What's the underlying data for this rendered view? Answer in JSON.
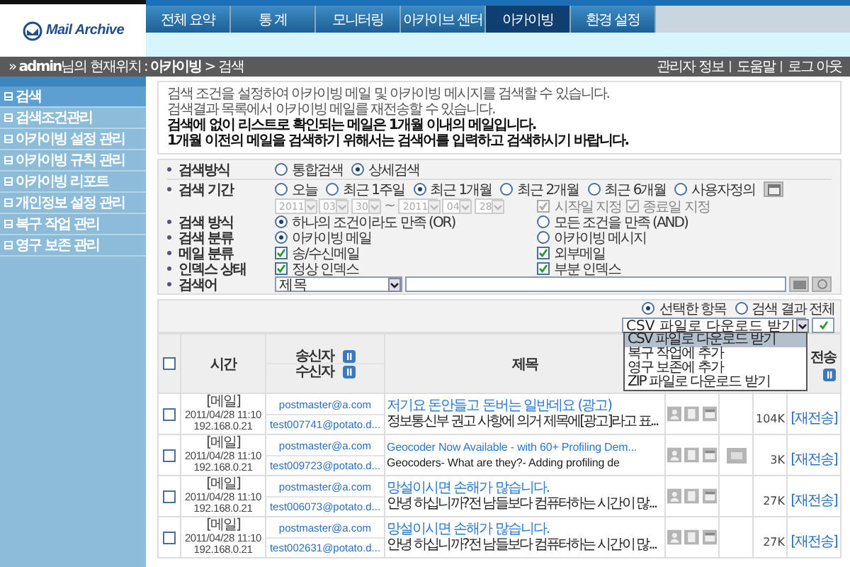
{
  "logo": {
    "text": "Mail Archive"
  },
  "top_tabs": [
    {
      "label": "전체 요약",
      "selected": false
    },
    {
      "label": "통 계",
      "selected": false
    },
    {
      "label": "모니터링",
      "selected": false
    },
    {
      "label": "아카이브 센터",
      "selected": false
    },
    {
      "label": "아카이빙",
      "selected": true
    },
    {
      "label": "환경 설정",
      "selected": false
    }
  ],
  "breadcrumb": {
    "location": "» **admin**님의 현재위치 : **아카이빙** > 검색",
    "links": [
      "관리자 정보",
      "도움말",
      "로그 아웃"
    ]
  },
  "sidebar": {
    "items": [
      {
        "label": "검색",
        "selected": true
      },
      {
        "label": "검색조건관리",
        "selected": false
      },
      {
        "label": "아카이빙 설정 관리",
        "selected": false
      },
      {
        "label": "아카이빙 규칙 관리",
        "selected": false
      },
      {
        "label": "아카이빙 리포트",
        "selected": false
      },
      {
        "label": "개인정보 설정 관리",
        "selected": false
      },
      {
        "label": "복구 작업 관리",
        "selected": false
      },
      {
        "label": "영구 보존 관리",
        "selected": false
      }
    ]
  },
  "notice": {
    "lines": [
      {
        "text": "검색 조건을 설정하여 아카이빙 메일 및 아카이빙 메시지를 검색할 수 있습니다.",
        "bold": false
      },
      {
        "text": "검색결과 목록에서 아카이빙 메일를 재전송할 수 있습니다.",
        "bold": false
      },
      {
        "text": "검색에 없이 리스트로 확인되는 메일은 1개월 이내의 메일입니다.",
        "bold": true
      },
      {
        "text": "1개월 이전의 메일을 검색하기 위해서는 검색어를 입력하고 검색하시기 바랍니다.",
        "bold": true
      }
    ]
  },
  "search_form": {
    "rows": [
      {
        "kind": "radio",
        "label": "검색방식",
        "options": [
          {
            "label": "통합검색",
            "selected": false
          },
          {
            "label": "상세검색",
            "selected": true
          }
        ]
      },
      {
        "kind": "period",
        "label": "검색 기간",
        "options": [
          {
            "label": "오늘",
            "selected": false
          },
          {
            "label": "최근 1주일",
            "selected": false
          },
          {
            "label": "최근 1개월",
            "selected": true
          },
          {
            "label": "최근 2개월",
            "selected": false
          },
          {
            "label": "최근 6개월",
            "selected": false
          },
          {
            "label": "사용자정의",
            "selected": false
          }
        ],
        "disabled": true,
        "start": [
          "2011",
          "03",
          "30"
        ],
        "separator": "~",
        "end": [
          "2011",
          "04",
          "28"
        ],
        "checks": [
          {
            "label": "시작일 지정",
            "checked": true
          },
          {
            "label": "종료일 지정",
            "checked": true
          }
        ]
      },
      {
        "kind": "radio",
        "label": "검색 방식",
        "options": [
          {
            "label": "하나의 조건이라도 만족 (OR)",
            "selected": true
          },
          {
            "label": "모든 조건을 만족 (AND)",
            "selected": false
          }
        ]
      },
      {
        "kind": "radio",
        "label": "검색 분류",
        "options": [
          {
            "label": "아카이빙 메일",
            "selected": true
          },
          {
            "label": "아카이빙 메시지",
            "selected": false
          }
        ]
      },
      {
        "kind": "check",
        "label": "메일 분류",
        "options": [
          {
            "label": "송/수신메일",
            "checked": true
          },
          {
            "label": "외부메일",
            "checked": true
          }
        ]
      },
      {
        "kind": "check",
        "label": "인덱스 상태",
        "options": [
          {
            "label": "정상 인덱스",
            "checked": true
          },
          {
            "label": "부분 인덱스",
            "checked": true
          }
        ]
      },
      {
        "kind": "keyword",
        "label": "검색어",
        "field": "제목"
      }
    ]
  },
  "export": {
    "scope": [
      {
        "label": "선택한 항목",
        "selected": true
      },
      {
        "label": "검색 결과 전체",
        "selected": false
      }
    ],
    "action": "CSV 파일로 다운로드 받기",
    "menu": [
      {
        "label": "CSV 파일로 다운로드 받기",
        "selected": true
      },
      {
        "label": "복구 작업에 추가",
        "selected": false
      },
      {
        "label": "영구 보존에 추가",
        "selected": false
      },
      {
        "label": "ZIP 파일로 다운로드 받기",
        "selected": false
      }
    ]
  },
  "table": {
    "select_all": {
      "checked": false
    },
    "columns": {
      "time": "시간",
      "sender": "송신자",
      "recipient": "수신자",
      "subject": "제목",
      "resend": "전송"
    },
    "rows": [
      {
        "checked": false,
        "type": "[메일]",
        "date": "2011/04/28 11:10",
        "ip": "192.168.0.21",
        "sender": "postmaster@a.com",
        "recipient": "test007741@potato.d...",
        "title": "저기요 돈안들고 돈버는 일반데요 (광고)",
        "preview": "정보통신부 권고 사항에 의거 제목에[광고]라고 표...",
        "attachment": false,
        "size": "104K",
        "resend": "[재전송]"
      },
      {
        "checked": false,
        "type": "[메일]",
        "date": "2011/04/28 11:10",
        "ip": "192.168.0.21",
        "sender": "postmaster@a.com",
        "recipient": "test009723@potato.d...",
        "title": "Geocoder Now Available - with 60+ Profiling Dem...",
        "preview": "Geocoders- What are they?- Adding profiling de",
        "attachment": true,
        "size": "3K",
        "resend": "[재전송]"
      },
      {
        "checked": false,
        "type": "[메일]",
        "date": "2011/04/28 11:10",
        "ip": "192.168.0.21",
        "sender": "postmaster@a.com",
        "recipient": "test006073@potato.d...",
        "title": "망설이시면 손해가 많습니다.",
        "preview": "안녕 하십니까?전 남들보다 컴퓨터하는 시간이 많...",
        "attachment": false,
        "size": "27K",
        "resend": "[재전송]"
      },
      {
        "checked": false,
        "type": "[메일]",
        "date": "2011/04/28 11:10",
        "ip": "192.168.0.21",
        "sender": "postmaster@a.com",
        "recipient": "test002631@potato.d...",
        "title": "망설이시면 손해가 많습니다.",
        "preview": "안녕 하십니까?전 남들보다 컴퓨터하는 시간이 많...",
        "attachment": false,
        "size": "27K",
        "resend": "[재전송]"
      }
    ]
  }
}
